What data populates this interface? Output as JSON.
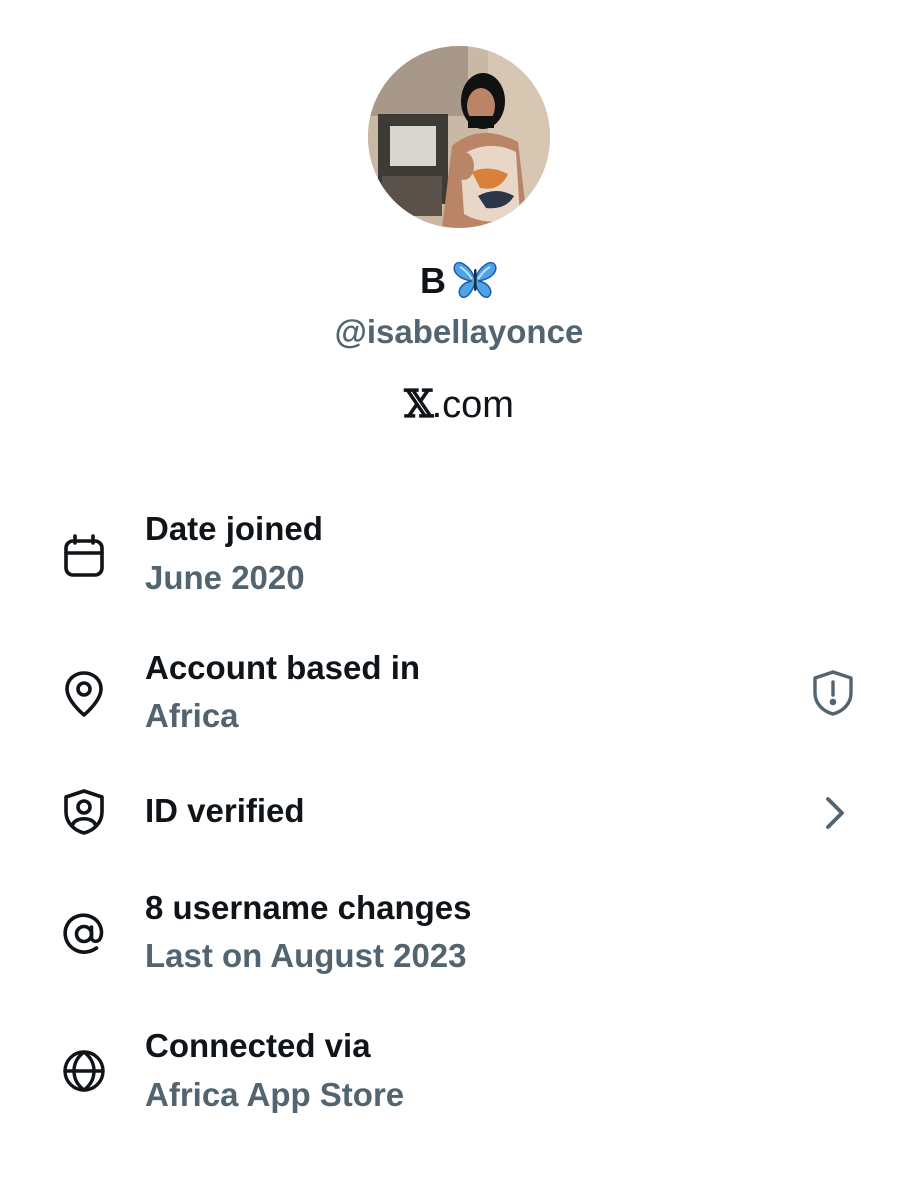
{
  "profile": {
    "display_name": "B",
    "handle": "@isabellayonce",
    "site": "X.com",
    "site_glyph": "𝕏",
    "site_suffix": ".com"
  },
  "details": [
    {
      "icon": "calendar-icon",
      "title": "Date joined",
      "value": "June 2020"
    },
    {
      "icon": "location-pin-icon",
      "title": "Account based in",
      "value": "Africa",
      "trailing_icon": "shield-alert-icon"
    },
    {
      "icon": "id-shield-icon",
      "title": "ID verified",
      "trailing_icon": "chevron-right-icon"
    },
    {
      "icon": "at-sign-icon",
      "title": "8 username changes",
      "value": "Last on August 2023"
    },
    {
      "icon": "globe-icon",
      "title": "Connected via",
      "value": "Africa App Store"
    }
  ],
  "colors": {
    "primary_text": "#0f1419",
    "secondary_text": "#536471",
    "butterfly": "#4fa3e8"
  }
}
